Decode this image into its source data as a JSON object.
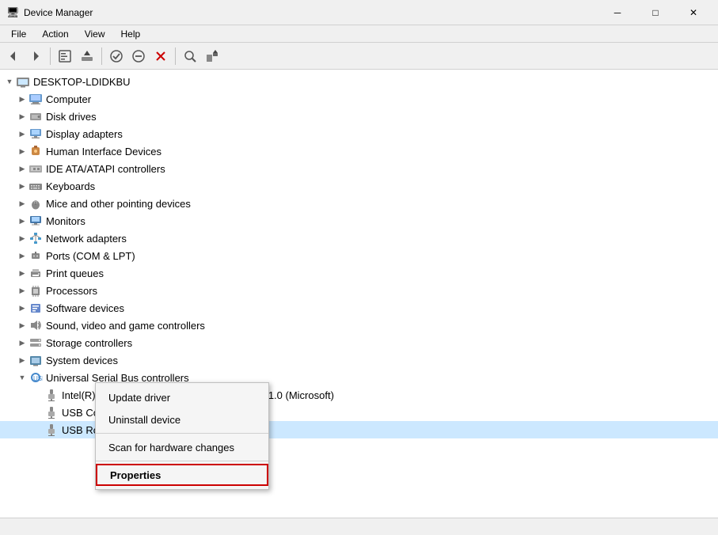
{
  "titleBar": {
    "title": "Device Manager",
    "iconSymbol": "🖥",
    "minBtn": "─",
    "maxBtn": "□",
    "closeBtn": "✕"
  },
  "menuBar": {
    "items": [
      "File",
      "Action",
      "View",
      "Help"
    ]
  },
  "toolbar": {
    "buttons": [
      {
        "name": "back",
        "symbol": "◀",
        "disabled": false
      },
      {
        "name": "forward",
        "symbol": "▶",
        "disabled": false
      },
      {
        "name": "separator1"
      },
      {
        "name": "properties",
        "symbol": "📋",
        "disabled": false
      },
      {
        "name": "update-driver",
        "symbol": "⬆",
        "disabled": false
      },
      {
        "name": "separator2"
      },
      {
        "name": "enable",
        "symbol": "✔",
        "disabled": false
      },
      {
        "name": "disable",
        "symbol": "⊘",
        "disabled": false
      },
      {
        "name": "uninstall",
        "symbol": "✕",
        "disabled": false
      },
      {
        "name": "separator3"
      },
      {
        "name": "scan",
        "symbol": "🔍",
        "disabled": false
      },
      {
        "name": "add-legacy",
        "symbol": "+",
        "disabled": false
      }
    ]
  },
  "tree": {
    "root": {
      "label": "DESKTOP-LDIDKBU",
      "expanded": true
    },
    "items": [
      {
        "id": "computer",
        "label": "Computer",
        "indent": 1,
        "icon": "💻",
        "expanded": false,
        "toggle": "▶"
      },
      {
        "id": "disk-drives",
        "label": "Disk drives",
        "indent": 1,
        "icon": "💾",
        "expanded": false,
        "toggle": "▶"
      },
      {
        "id": "display-adapters",
        "label": "Display adapters",
        "indent": 1,
        "icon": "🖥",
        "expanded": false,
        "toggle": "▶"
      },
      {
        "id": "hid",
        "label": "Human Interface Devices",
        "indent": 1,
        "icon": "🎮",
        "expanded": false,
        "toggle": "▶"
      },
      {
        "id": "ide",
        "label": "IDE ATA/ATAPI controllers",
        "indent": 1,
        "icon": "⚙",
        "expanded": false,
        "toggle": "▶"
      },
      {
        "id": "keyboards",
        "label": "Keyboards",
        "indent": 1,
        "icon": "⌨",
        "expanded": false,
        "toggle": "▶"
      },
      {
        "id": "mice",
        "label": "Mice and other pointing devices",
        "indent": 1,
        "icon": "🖱",
        "expanded": false,
        "toggle": "▶"
      },
      {
        "id": "monitors",
        "label": "Monitors",
        "indent": 1,
        "icon": "🖥",
        "expanded": false,
        "toggle": "▶"
      },
      {
        "id": "network",
        "label": "Network adapters",
        "indent": 1,
        "icon": "🌐",
        "expanded": false,
        "toggle": "▶"
      },
      {
        "id": "ports",
        "label": "Ports (COM & LPT)",
        "indent": 1,
        "icon": "🔌",
        "expanded": false,
        "toggle": "▶"
      },
      {
        "id": "print-queues",
        "label": "Print queues",
        "indent": 1,
        "icon": "🖨",
        "expanded": false,
        "toggle": "▶"
      },
      {
        "id": "processors",
        "label": "Processors",
        "indent": 1,
        "icon": "⚙",
        "expanded": false,
        "toggle": "▶"
      },
      {
        "id": "software-devices",
        "label": "Software devices",
        "indent": 1,
        "icon": "📦",
        "expanded": false,
        "toggle": "▶"
      },
      {
        "id": "sound",
        "label": "Sound, video and game controllers",
        "indent": 1,
        "icon": "🔊",
        "expanded": false,
        "toggle": "▶"
      },
      {
        "id": "storage",
        "label": "Storage controllers",
        "indent": 1,
        "icon": "💾",
        "expanded": false,
        "toggle": "▶"
      },
      {
        "id": "system-devices",
        "label": "System devices",
        "indent": 1,
        "icon": "🖥",
        "expanded": false,
        "toggle": "▶"
      },
      {
        "id": "usb",
        "label": "Universal Serial Bus controllers",
        "indent": 1,
        "icon": "🔌",
        "expanded": true,
        "toggle": "▼"
      },
      {
        "id": "usb-intel",
        "label": "Intel(R) USB 3.0 eXtensible Host Controller - 1.0 (Microsoft)",
        "indent": 2,
        "icon": "🔌",
        "expanded": false,
        "toggle": ""
      },
      {
        "id": "usb-composite",
        "label": "USB Composite Device",
        "indent": 2,
        "icon": "🔌",
        "expanded": false,
        "toggle": ""
      },
      {
        "id": "usb-root",
        "label": "USB Root Hub (USB 3.0)",
        "indent": 2,
        "icon": "🔌",
        "expanded": false,
        "toggle": "",
        "selected": true
      }
    ]
  },
  "contextMenu": {
    "items": [
      {
        "id": "update-driver",
        "label": "Update driver"
      },
      {
        "id": "uninstall-device",
        "label": "Uninstall device"
      },
      {
        "id": "separator"
      },
      {
        "id": "scan-hardware",
        "label": "Scan for hardware changes"
      },
      {
        "id": "separator2"
      },
      {
        "id": "properties",
        "label": "Properties",
        "bold": true,
        "highlighted": true
      }
    ]
  },
  "statusBar": {
    "text": ""
  }
}
